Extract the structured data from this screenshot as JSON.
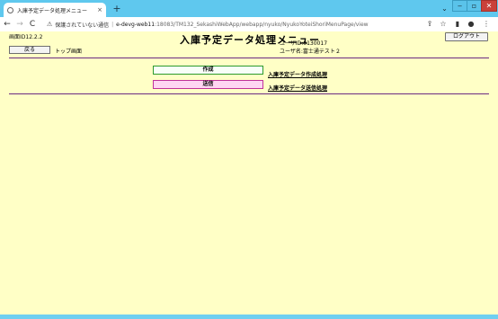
{
  "browser": {
    "tab": {
      "title": "入庫予定データ処理メニュー",
      "close": "×"
    },
    "new_tab": "+",
    "window": {
      "dropdown": "⌄",
      "minimize": "‒",
      "maximize": "▫",
      "close": "✕"
    },
    "nav": {
      "back": "←",
      "forward": "→",
      "reload": "C"
    },
    "address": {
      "security_label": "保護されていない通信",
      "host": "e-devg-web11",
      "path": ":18083/TM132_SekashiWebApp/webapp/nyuko/NyukoYoteiShoriMenuPage/view"
    },
    "toolbar_icons": [
      "share-icon",
      "star-icon",
      "sidepanel-icon",
      "profile-icon",
      "menu-icon"
    ]
  },
  "page": {
    "screen_id": "画面ID12.2.2",
    "title": "入庫予定データ処理メニュー",
    "logout_label": "ログアウト",
    "back_label": "戻る",
    "top_link": "トップ画面",
    "user": {
      "id_line": "ユーザID:0130017",
      "name_line": "ユーザ名:富士通テスト２"
    },
    "actions": [
      {
        "label": "作成",
        "description": "入庫予定データ作成処理"
      },
      {
        "label": "送信",
        "description": "入庫予定データ送信処理"
      }
    ]
  },
  "colors": {
    "page_background": "#ffffc6",
    "divider": "#6b2b82",
    "create_border": "#2c9a2c",
    "send_fill": "#ffd6f2",
    "chrome_frame": "#5fc8ee"
  }
}
